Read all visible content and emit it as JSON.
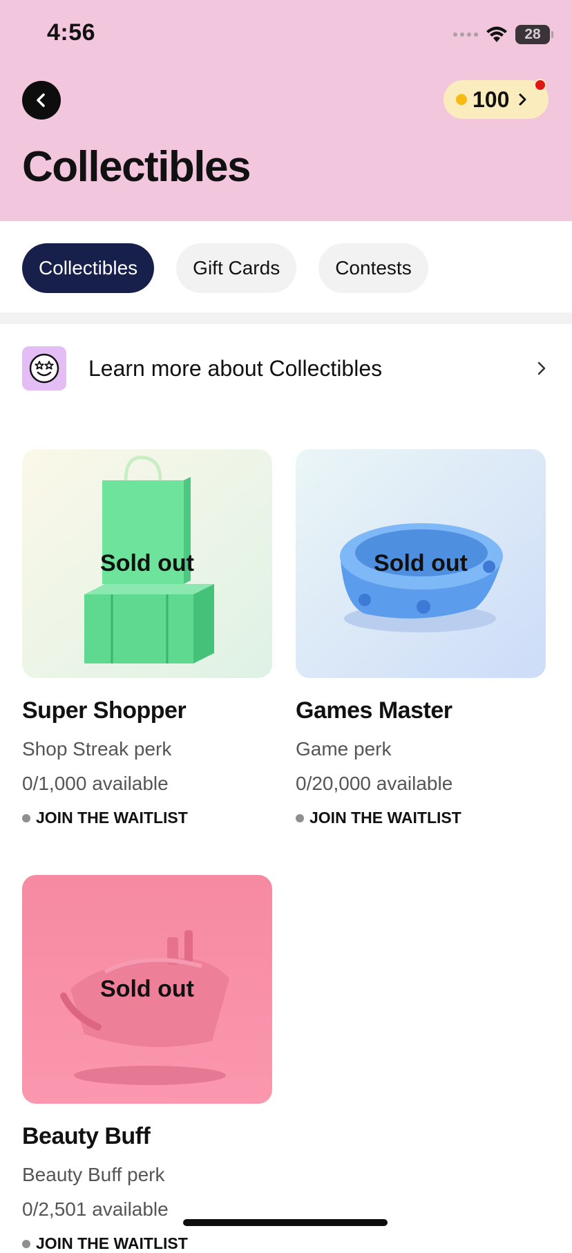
{
  "status_bar": {
    "time": "4:56",
    "battery": "28"
  },
  "header": {
    "back_icon": "chevron-left-icon",
    "points": "100",
    "title": "Collectibles",
    "colors": {
      "background": "#f2c6dc",
      "points_pill": "#fbecbe",
      "coin": "#f6bb12",
      "notification": "#e01515"
    }
  },
  "tabs": [
    {
      "label": "Collectibles",
      "active": true
    },
    {
      "label": "Gift Cards",
      "active": false
    },
    {
      "label": "Contests",
      "active": false
    }
  ],
  "learn_more": {
    "label": "Learn more about Collectibles",
    "icon": "star-eyes-face-icon"
  },
  "cards": [
    {
      "name": "Super Shopper",
      "perk": "Shop Streak perk",
      "availability": "0/1,000 available",
      "status": "Sold out",
      "action": "JOIN THE WAITLIST",
      "image": "shopping-bag-gift-box"
    },
    {
      "name": "Games Master",
      "perk": "Game perk",
      "availability": "0/20,000 available",
      "status": "Sold out",
      "action": "JOIN THE WAITLIST",
      "image": "pet-bowl"
    },
    {
      "name": "Beauty Buff",
      "perk": "Beauty Buff perk",
      "availability": "0/2,501 available",
      "status": "Sold out",
      "action": "JOIN THE WAITLIST",
      "image": "makeup-bag"
    }
  ],
  "colors": {
    "active_tab": "#16204b",
    "inactive_tab": "#f2f2f2"
  }
}
